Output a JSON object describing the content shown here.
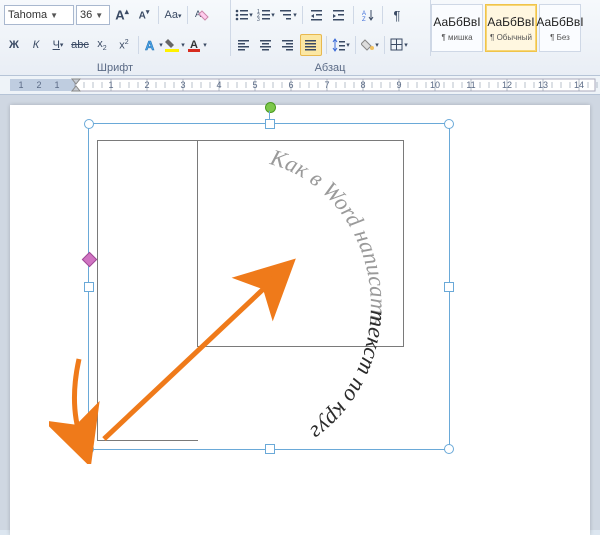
{
  "font": {
    "name": "Tahoma",
    "size": "36",
    "grow_tip": "A",
    "shrink_tip": "A",
    "clear_tip": "Aa",
    "bold": "Ж",
    "italic": "К",
    "underline": "Ч",
    "strike": "abc",
    "sub": "x",
    "sup": "x",
    "group_label": "Шрифт"
  },
  "para": {
    "group_label": "Абзац"
  },
  "styles": {
    "preview": "АаБбВвІ",
    "tile1_name": "¶ мишка",
    "tile2_name": "¶ Обычный",
    "tile3_name": "¶ Без"
  },
  "ruler": {
    "marks": [
      "",
      "1",
      "2",
      "1",
      "",
      "1",
      "2",
      "3",
      "4",
      "5",
      "6",
      "7",
      "8",
      "9",
      "10",
      "11",
      "12",
      "13",
      "14"
    ]
  },
  "canvas": {
    "arc_text": "Как в Word написать текст по кругу"
  },
  "colors": {
    "accent_orange": "#ef7a1a",
    "handle_blue": "#6aa9d8"
  }
}
